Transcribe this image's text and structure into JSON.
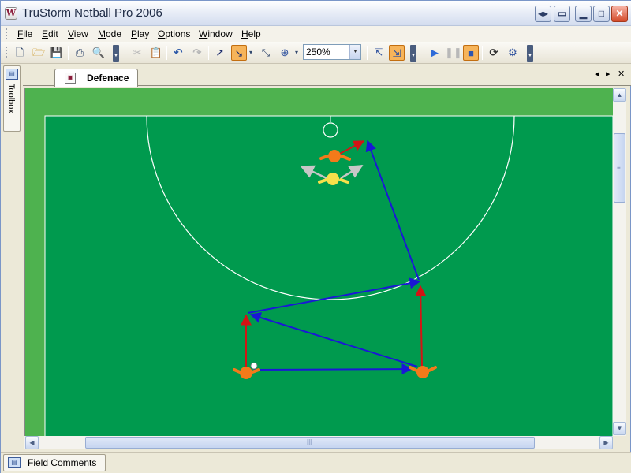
{
  "window": {
    "title": "TruStorm Netball Pro 2006",
    "icon_letter": "W",
    "buttons": [
      "◂▸",
      "▭",
      "▁",
      "□",
      "✕"
    ]
  },
  "menu": {
    "items": [
      "File",
      "Edit",
      "View",
      "Mode",
      "Play",
      "Options",
      "Window",
      "Help"
    ]
  },
  "toolbar": {
    "zoom_value": "250%",
    "icons": [
      "new-icon",
      "open-icon",
      "save-icon",
      "print-icon",
      "print-preview-icon",
      "cut-icon",
      "paste-icon",
      "undo-icon",
      "redo-icon",
      "select-icon",
      "draw-line-icon",
      "resize-icon",
      "zoom-icon",
      "export-icon",
      "import-icon",
      "play-icon",
      "pause-icon",
      "stop-icon",
      "refresh-icon",
      "settings-icon"
    ]
  },
  "left_panel": {
    "toolbox_label": "Toolbox"
  },
  "document": {
    "tab_label": "Defenace",
    "nav_prev": "◂",
    "nav_next": "▸",
    "close": "✕"
  },
  "bottom_panel": {
    "field_comments_label": "Field Comments"
  },
  "colors": {
    "court_outer": "#4eb24f",
    "court_inner": "#009a4e",
    "player_attack": "#f37a1a",
    "player_defense": "#f7e04b",
    "pass_arrow": "#1a17d6",
    "movement_arrow": "#d41414",
    "defender_arrow": "#b8b8b8"
  }
}
